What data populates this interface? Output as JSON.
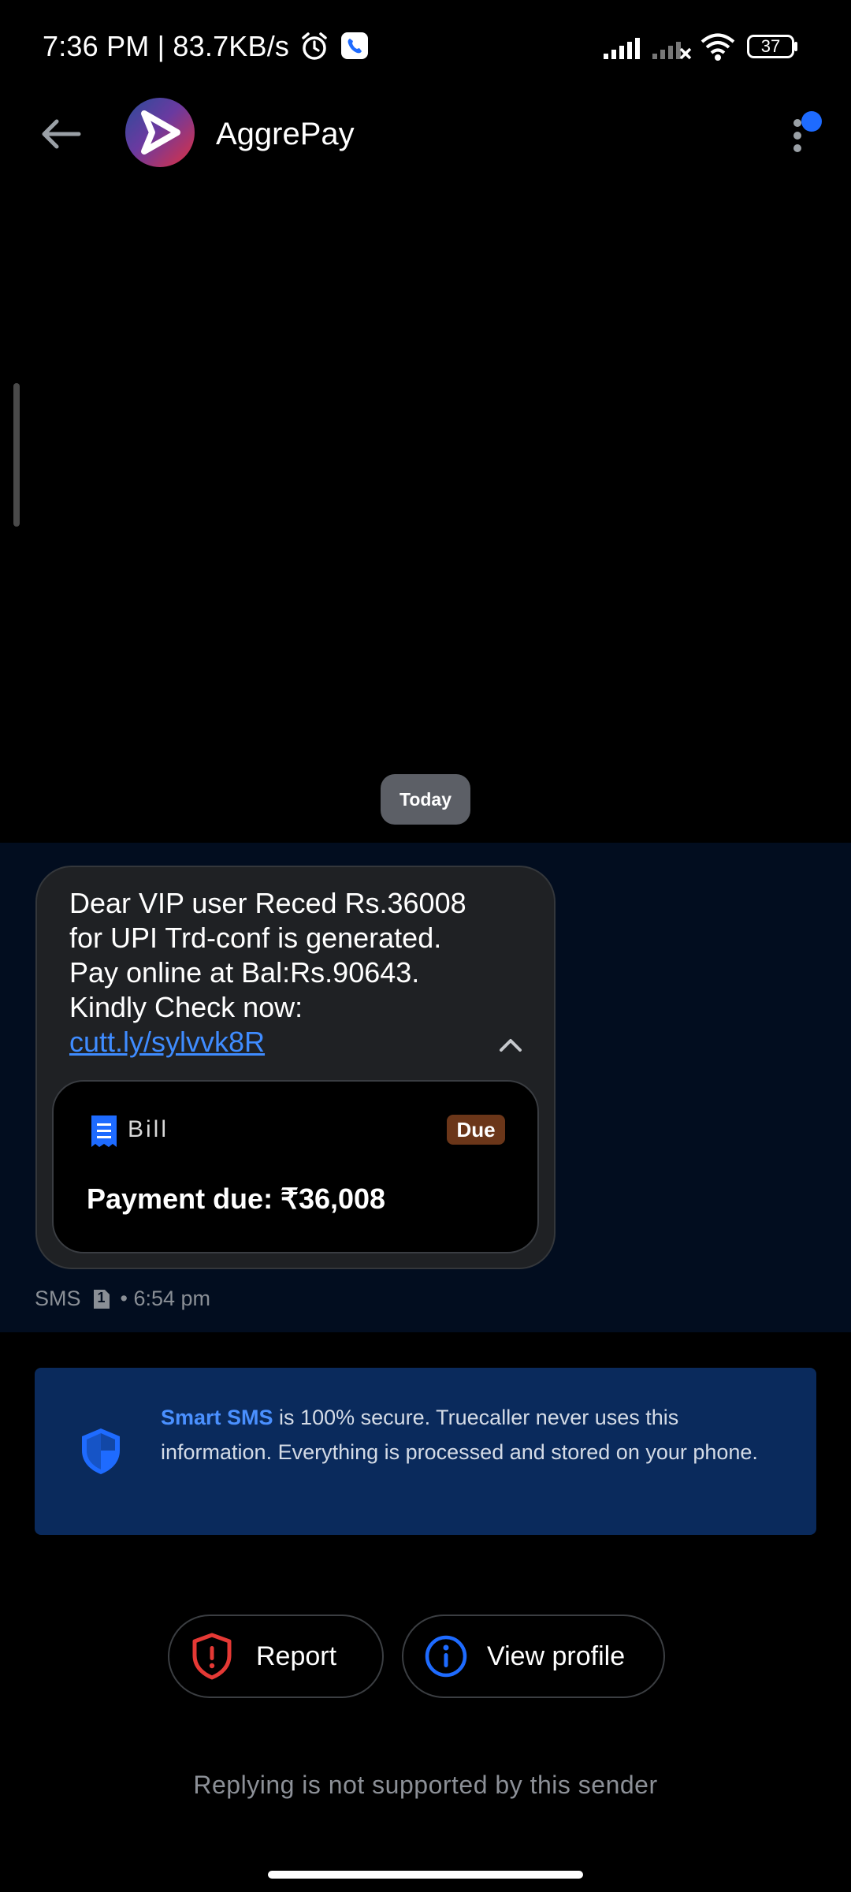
{
  "status_bar": {
    "time_speed": "7:36 PM | 83.7KB/s",
    "battery": "37"
  },
  "header": {
    "title": "AggrePay"
  },
  "conversation": {
    "date_chip": "Today",
    "message": {
      "text": "Dear VIP user Reced Rs.36008 for UPI Trd-conf is generated. Pay online at Bal:Rs.90643. Kindly Check now: ",
      "link": "cutt.ly/sylvvk8R"
    },
    "bill_card": {
      "label": "Bill",
      "badge": "Due",
      "payment_due": "Payment due: ₹36,008"
    },
    "meta": {
      "channel": "SMS",
      "sim_number": "1",
      "time": "• 6:54 pm"
    }
  },
  "info_card": {
    "highlight": "Smart SMS",
    "text": " is 100% secure. Truecaller never uses this information. Everything is processed and stored on your phone."
  },
  "actions": {
    "report_label": "Report",
    "view_profile_label": "View profile"
  },
  "footer_note": "Replying is not supported by this sender",
  "icons": {
    "back": "back-arrow-icon",
    "more": "more-vertical-icon",
    "collapse": "chevron-up-icon",
    "bill": "receipt-icon",
    "info_shield": "shield-icon",
    "report": "report-shield-icon",
    "view_profile": "info-icon"
  },
  "colors": {
    "background": "#000000",
    "message_band": "#020d1f",
    "bubble": "#1f2124",
    "link": "#3f8cff",
    "info_card": "#0a2a5c",
    "due_badge": "#6b3619",
    "report_red": "#e53935",
    "accent_blue": "#1e6bff"
  }
}
